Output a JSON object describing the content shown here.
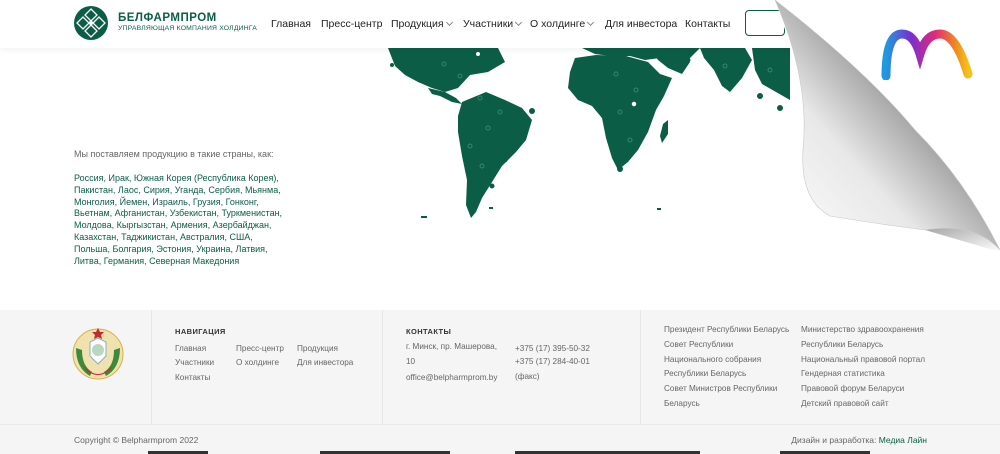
{
  "header": {
    "logo_name": "БЕЛФАРМПРОМ",
    "logo_subtitle": "УПРАВЛЯЮЩАЯ КОМПАНИЯ ХОЛДИНГА",
    "nav": [
      {
        "label": "Главная",
        "dropdown": false
      },
      {
        "label": "Пресс-центр",
        "dropdown": false
      },
      {
        "label": "Продукция",
        "dropdown": true
      },
      {
        "label": "Участники",
        "dropdown": true
      },
      {
        "label": "О холдинге",
        "dropdown": true
      },
      {
        "label": "Для инвестора",
        "dropdown": false
      },
      {
        "label": "Контакты",
        "dropdown": false
      }
    ]
  },
  "map": {
    "intro": "Мы поставляем продукцию в такие страны, как:",
    "countries": "Россия, Ирак, Южная Корея (Республика Корея), Пакистан, Лаос, Сирия, Уганда, Сербия, Мьянма, Монголия, Йемен, Израиль, Грузия, Гонконг, Вьетнам, Афганистан, Узбекистан, Туркменистан, Молдова, Кыргызстан, Армения, Азербайджан, Казахстан, Таджикистан, Австралия, США, Польша, Болгария, Эстония, Украина, Латвия, Литва, Германия, Северная Македония",
    "land_color": "#0b5e45"
  },
  "footer": {
    "nav_title": "НАВИГАЦИЯ",
    "nav_links": [
      "Главная",
      "Пресс-центр",
      "Продукция",
      "Участники",
      "О холдинге",
      "Для инвестора",
      "Контакты"
    ],
    "contacts_title": "КОНТАКТЫ",
    "address": "г. Минск, пр. Машерова, 10",
    "email": "office@belpharmprom.by",
    "phone1": "+375 (17) 395-50-32",
    "phone2": "+375 (17) 284-40-01 (факс)",
    "links_col1": [
      "Президент Республики Беларусь",
      "Совет Республики Национального собрания Республики Беларусь",
      "Совет Министров Республики Беларусь"
    ],
    "links_col2": [
      "Министерство здравоохранения Республики Беларусь",
      "Национальный правовой портал",
      "Гендерная статистика",
      "Правовой форум Беларуси",
      "Детский правовой сайт"
    ],
    "copyright": "Copyright © Belpharmprom 2022",
    "credits_prefix": "Дизайн и разработка:",
    "credits_link": "Медиа Лайн"
  },
  "colors": {
    "brand": "#0b5e45",
    "footer_bg": "#f5f5f5"
  },
  "icons": [
    "logo-ornament-icon",
    "chevron-down-icon",
    "coat-of-arms-icon",
    "page-curl-icon",
    "brand-m-logo-icon"
  ]
}
